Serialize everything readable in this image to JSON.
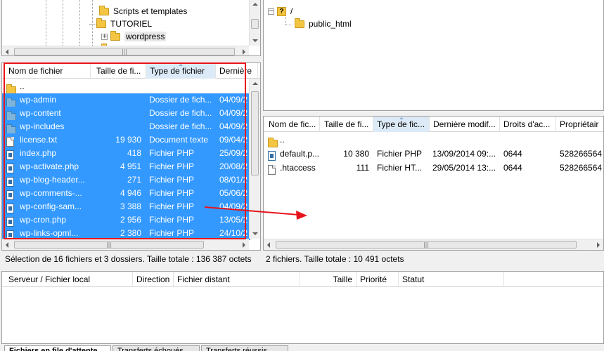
{
  "local_tree": {
    "items": [
      {
        "label": "Scripts et templates"
      },
      {
        "label": "TUTORIEL"
      },
      {
        "label": "wordpress"
      }
    ]
  },
  "remote_tree": {
    "items": [
      {
        "label": "/"
      },
      {
        "label": "public_html"
      }
    ]
  },
  "local_list": {
    "columns": [
      "Nom de fichier",
      "Taille de fi...",
      "Type de fichier",
      "Dernière"
    ],
    "rows": [
      {
        "name": "..",
        "size": "",
        "type": "",
        "date": "",
        "icon": "folder-icon"
      },
      {
        "name": "wp-admin",
        "size": "",
        "type": "Dossier de fich...",
        "date": "04/09/2",
        "icon": "folder-icon"
      },
      {
        "name": "wp-content",
        "size": "",
        "type": "Dossier de fich...",
        "date": "04/09/2",
        "icon": "folder-icon"
      },
      {
        "name": "wp-includes",
        "size": "",
        "type": "Dossier de fich...",
        "date": "04/09/2",
        "icon": "folder-icon"
      },
      {
        "name": "license.txt",
        "size": "19 930",
        "type": "Document texte",
        "date": "09/04/2",
        "icon": "text-file-icon"
      },
      {
        "name": "index.php",
        "size": "418",
        "type": "Fichier PHP",
        "date": "25/09/2",
        "icon": "php-file-icon"
      },
      {
        "name": "wp-activate.php",
        "size": "4 951",
        "type": "Fichier PHP",
        "date": "20/08/2",
        "icon": "php-file-icon"
      },
      {
        "name": "wp-blog-header...",
        "size": "271",
        "type": "Fichier PHP",
        "date": "08/01/2",
        "icon": "php-file-icon"
      },
      {
        "name": "wp-comments-...",
        "size": "4 946",
        "type": "Fichier PHP",
        "date": "05/06/2",
        "icon": "php-file-icon"
      },
      {
        "name": "wp-config-sam...",
        "size": "3 388",
        "type": "Fichier PHP",
        "date": "04/09/2",
        "icon": "php-file-icon"
      },
      {
        "name": "wp-cron.php",
        "size": "2 956",
        "type": "Fichier PHP",
        "date": "13/05/2",
        "icon": "php-file-icon"
      },
      {
        "name": "wp-links-opml...",
        "size": "2 380",
        "type": "Fichier PHP",
        "date": "24/10/2",
        "icon": "php-file-icon"
      }
    ],
    "status": "Sélection de 16 fichiers et 3 dossiers. Taille totale : 136 387 octets"
  },
  "remote_list": {
    "columns": [
      "Nom de fic...",
      "Taille de fi...",
      "Type de fic...",
      "Dernière modif...",
      "Droits d'ac...",
      "Propriétair"
    ],
    "rows": [
      {
        "name": "..",
        "size": "",
        "type": "",
        "date": "",
        "perms": "",
        "owner": "",
        "icon": "folder-icon"
      },
      {
        "name": "default.p...",
        "size": "10 380",
        "type": "Fichier PHP",
        "date": "13/09/2014 09:...",
        "perms": "0644",
        "owner": "528266564",
        "icon": "php-file-icon"
      },
      {
        "name": ".htaccess",
        "size": "111",
        "type": "Fichier HT...",
        "date": "29/05/2014 13:...",
        "perms": "0644",
        "owner": "528266564",
        "icon": "text-file-icon"
      }
    ],
    "status": "2 fichiers. Taille totale : 10 491 octets"
  },
  "queue": {
    "columns": [
      "Serveur / Fichier local",
      "Direction",
      "Fichier distant",
      "Taille",
      "Priorité",
      "Statut"
    ],
    "tabs": [
      "Fichiers en file d'attente",
      "Transferts échoués",
      "Transferts réussis"
    ]
  },
  "colors": {
    "selection": "#3399ff",
    "highlight_box": "#e8141c",
    "arrow": "#e8141c"
  }
}
